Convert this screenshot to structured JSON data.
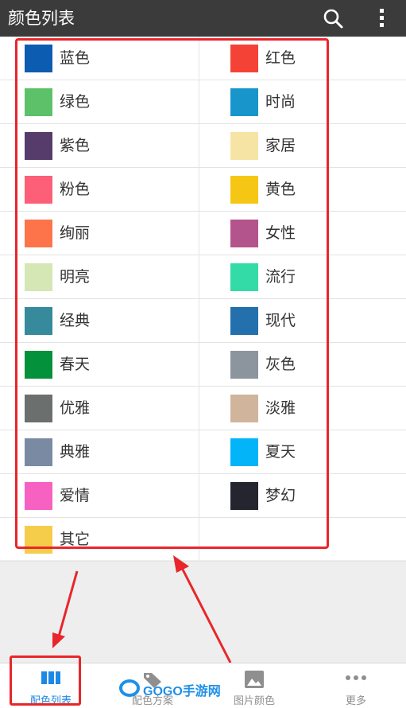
{
  "header": {
    "title": "颜色列表",
    "search_icon": "search-icon",
    "more_icon": "more-vert-icon"
  },
  "colors": [
    [
      {
        "label": "蓝色",
        "color": "#0c5cb1"
      },
      {
        "label": "红色",
        "color": "#f44336"
      }
    ],
    [
      {
        "label": "绿色",
        "color": "#5cc168"
      },
      {
        "label": "时尚",
        "color": "#1896cc"
      }
    ],
    [
      {
        "label": "紫色",
        "color": "#553c6b"
      },
      {
        "label": "家居",
        "color": "#f6e4a5"
      }
    ],
    [
      {
        "label": "粉色",
        "color": "#fc5f77"
      },
      {
        "label": "黄色",
        "color": "#f6c615"
      }
    ],
    [
      {
        "label": "绚丽",
        "color": "#fd744a"
      },
      {
        "label": "女性",
        "color": "#b4548c"
      }
    ],
    [
      {
        "label": "明亮",
        "color": "#d4e7b4"
      },
      {
        "label": "流行",
        "color": "#33dba6"
      }
    ],
    [
      {
        "label": "经典",
        "color": "#368a9c"
      },
      {
        "label": "现代",
        "color": "#2370ad"
      }
    ],
    [
      {
        "label": "春天",
        "color": "#04913c"
      },
      {
        "label": "灰色",
        "color": "#8c949e"
      }
    ],
    [
      {
        "label": "优雅",
        "color": "#6b706f"
      },
      {
        "label": "淡雅",
        "color": "#d0b49c"
      }
    ],
    [
      {
        "label": "典雅",
        "color": "#7a8aa3"
      },
      {
        "label": "夏天",
        "color": "#03b4f8"
      }
    ],
    [
      {
        "label": "爱情",
        "color": "#f661c2"
      },
      {
        "label": "梦幻",
        "color": "#24252f"
      }
    ],
    [
      {
        "label": "其它",
        "color": "#f6cd4a"
      },
      null
    ]
  ],
  "tabs": [
    {
      "label": "配色列表",
      "icon": "grid-columns-icon",
      "active": true
    },
    {
      "label": "配色方案",
      "icon": "tag-icon",
      "active": false
    },
    {
      "label": "图片颜色",
      "icon": "image-icon",
      "active": false
    },
    {
      "label": "更多",
      "icon": "more-horiz-icon",
      "active": false
    }
  ],
  "watermark": {
    "text": "GOGO手游网"
  },
  "colors_theme": {
    "accent": "#1e88e5",
    "highlight": "#e8262b",
    "header_bg": "#3b3b3b"
  }
}
